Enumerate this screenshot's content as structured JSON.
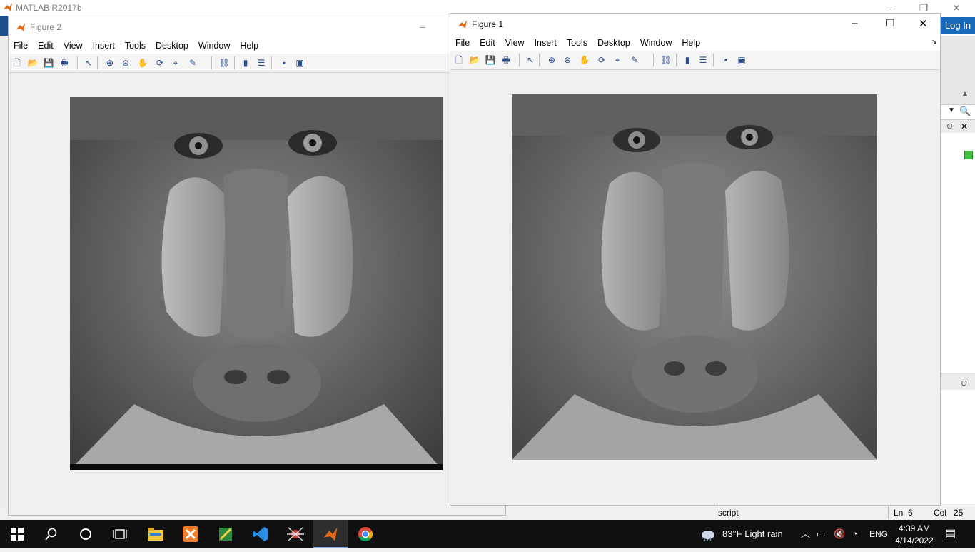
{
  "matlab": {
    "title": "MATLAB R2017b",
    "login_label": "Log In",
    "status_script": "script",
    "status_ln_label": "Ln",
    "status_ln": "6",
    "status_col_label": "Col",
    "status_col": "25"
  },
  "figure2": {
    "title": "Figure 2",
    "menu": [
      "File",
      "Edit",
      "View",
      "Insert",
      "Tools",
      "Desktop",
      "Window",
      "Help"
    ]
  },
  "figure1": {
    "title": "Figure 1",
    "menu": [
      "File",
      "Edit",
      "View",
      "Insert",
      "Tools",
      "Desktop",
      "Window",
      "Help"
    ]
  },
  "toolbar_icons": [
    "new-figure-icon",
    "open-icon",
    "save-icon",
    "print-icon",
    "pointer-icon",
    "zoom-in-icon",
    "zoom-out-icon",
    "pan-icon",
    "rotate-icon",
    "data-cursor-icon",
    "brush-icon",
    "link-icon",
    "colorbar-icon",
    "legend-icon",
    "hide-plot-tools-icon",
    "show-plot-tools-icon"
  ],
  "taskbar": {
    "weather": "83°F  Light rain",
    "lang": "ENG",
    "time": "4:39 AM",
    "date": "4/14/2022"
  },
  "colors": {
    "login": "#1669b8",
    "taskbar": "#101010",
    "matlab_orange": "#e16b1a"
  }
}
